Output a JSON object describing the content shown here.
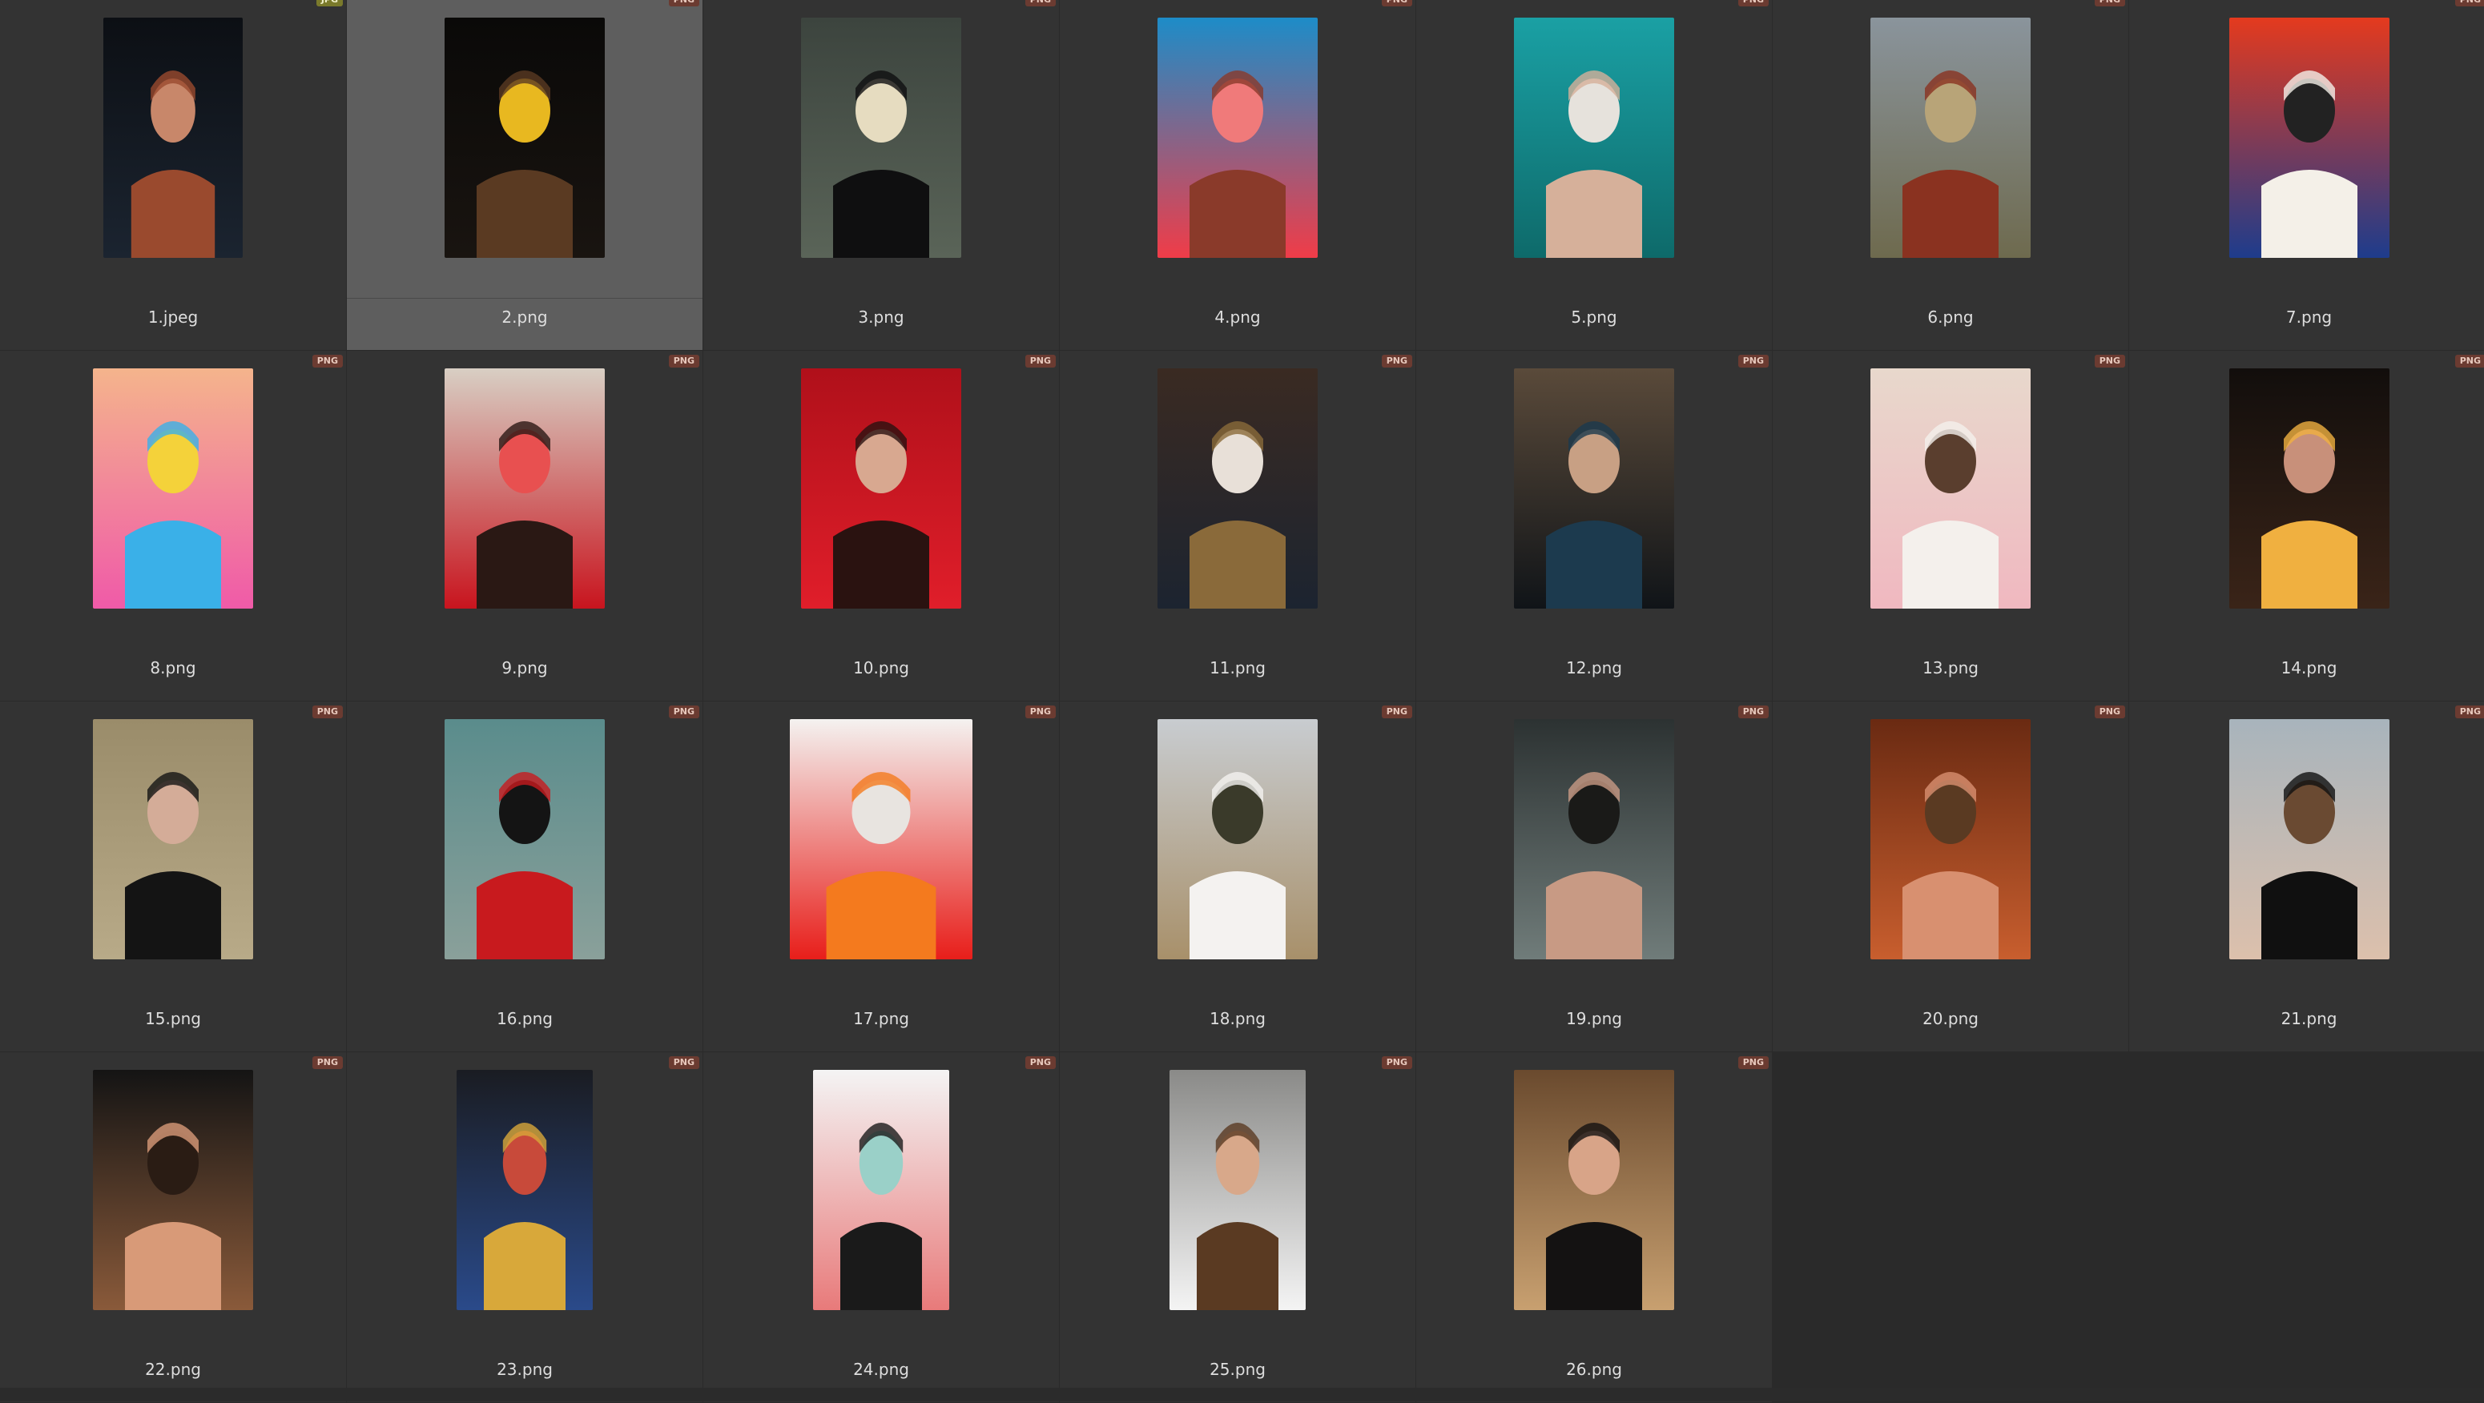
{
  "gallery": {
    "items": [
      {
        "filename": "1.jpeg",
        "badge": "JPG",
        "format": "jpg",
        "colors": [
          "#0c0f14",
          "#1b2430",
          "#9a4a2e",
          "#c8876a"
        ],
        "selected": false
      },
      {
        "filename": "2.png",
        "badge": "PNG",
        "format": "png",
        "colors": [
          "#0a0908",
          "#191410",
          "#5a3a22",
          "#e8b820"
        ],
        "selected": true
      },
      {
        "filename": "3.png",
        "badge": "PNG",
        "format": "png",
        "colors": [
          "#3c443e",
          "#5a6458",
          "#0f0f10",
          "#e6dcc0"
        ],
        "selected": false
      },
      {
        "filename": "4.png",
        "badge": "PNG",
        "format": "png",
        "colors": [
          "#1d8cc8",
          "#f03c48",
          "#8a3a2a",
          "#f07a7a"
        ],
        "selected": false
      },
      {
        "filename": "5.png",
        "badge": "PNG",
        "format": "png",
        "colors": [
          "#1aa0a4",
          "#0e6a6a",
          "#d6b09a",
          "#e6e2dc"
        ],
        "selected": false
      },
      {
        "filename": "6.png",
        "badge": "PNG",
        "format": "png",
        "colors": [
          "#8a949c",
          "#6e6a4e",
          "#8a3220",
          "#b8a478"
        ],
        "selected": false
      },
      {
        "filename": "7.png",
        "badge": "PNG",
        "format": "png",
        "colors": [
          "#e43a1e",
          "#1e3c8c",
          "#f4f0e8",
          "#222222"
        ],
        "selected": false
      },
      {
        "filename": "8.png",
        "badge": "PNG",
        "format": "png",
        "colors": [
          "#f4b48c",
          "#f05aa8",
          "#3ab0e8",
          "#f4d23a"
        ],
        "selected": false
      },
      {
        "filename": "9.png",
        "badge": "PNG",
        "format": "png",
        "colors": [
          "#d8cfc4",
          "#c8141e",
          "#2a1814",
          "#e85050"
        ],
        "selected": false
      },
      {
        "filename": "10.png",
        "badge": "PNG",
        "format": "png",
        "colors": [
          "#b0101a",
          "#e01e2a",
          "#2a1210",
          "#d8a890"
        ],
        "selected": false
      },
      {
        "filename": "11.png",
        "badge": "PNG",
        "format": "png",
        "colors": [
          "#3a2a22",
          "#1c2430",
          "#8a6a3a",
          "#e8e0d8"
        ],
        "selected": false
      },
      {
        "filename": "12.png",
        "badge": "PNG",
        "format": "png",
        "colors": [
          "#5a4a3a",
          "#101418",
          "#1c3a4e",
          "#c8a084"
        ],
        "selected": false
      },
      {
        "filename": "13.png",
        "badge": "PNG",
        "format": "png",
        "colors": [
          "#e8d8cc",
          "#f0b8c0",
          "#f4f0ec",
          "#5a3e2e"
        ],
        "selected": false
      },
      {
        "filename": "14.png",
        "badge": "PNG",
        "format": "png",
        "colors": [
          "#120e0c",
          "#3a2418",
          "#f0b040",
          "#c8907a"
        ],
        "selected": false
      },
      {
        "filename": "15.png",
        "badge": "PNG",
        "format": "png",
        "colors": [
          "#9a8c6a",
          "#b8aa88",
          "#141414",
          "#d4ac98"
        ],
        "selected": false
      },
      {
        "filename": "16.png",
        "badge": "PNG",
        "format": "png",
        "colors": [
          "#5a8c8c",
          "#8aa09a",
          "#c81a1e",
          "#141414"
        ],
        "selected": false
      },
      {
        "filename": "17.png",
        "badge": "PNG",
        "format": "png",
        "colors": [
          "#f4f2f0",
          "#e81e1a",
          "#f47a1e",
          "#e8e4e0"
        ],
        "selected": false
      },
      {
        "filename": "18.png",
        "badge": "PNG",
        "format": "png",
        "colors": [
          "#c8ccd0",
          "#a8906a",
          "#f4f2f0",
          "#3a3a2a"
        ],
        "selected": false
      },
      {
        "filename": "19.png",
        "badge": "PNG",
        "format": "png",
        "colors": [
          "#2c3232",
          "#707c7a",
          "#c89a84",
          "#1a1a18"
        ],
        "selected": false
      },
      {
        "filename": "20.png",
        "badge": "PNG",
        "format": "png",
        "colors": [
          "#6a2a12",
          "#c85e2e",
          "#d89070",
          "#5a3a22"
        ],
        "selected": false
      },
      {
        "filename": "21.png",
        "badge": "PNG",
        "format": "png",
        "colors": [
          "#a8b4bc",
          "#dcc0ac",
          "#101010",
          "#6a4a32"
        ],
        "selected": false
      },
      {
        "filename": "22.png",
        "badge": "PNG",
        "format": "png",
        "colors": [
          "#141414",
          "#8a5a3a",
          "#d89a78",
          "#2a1c14"
        ],
        "selected": false
      },
      {
        "filename": "23.png",
        "badge": "PNG",
        "format": "png",
        "colors": [
          "#1a1c22",
          "#2a4a8a",
          "#d8a83a",
          "#c84a3a"
        ],
        "selected": false
      },
      {
        "filename": "24.png",
        "badge": "PNG",
        "format": "png",
        "colors": [
          "#f4f4f4",
          "#e87a7a",
          "#1a1a1a",
          "#9ad0c8"
        ],
        "selected": false
      },
      {
        "filename": "25.png",
        "badge": "PNG",
        "format": "png",
        "colors": [
          "#8a8a88",
          "#f4f4f4",
          "#5a3a22",
          "#d8a88a"
        ],
        "selected": false
      },
      {
        "filename": "26.png",
        "badge": "PNG",
        "format": "png",
        "colors": [
          "#6a4a2e",
          "#c8a070",
          "#141212",
          "#d8a488"
        ],
        "selected": false
      }
    ]
  }
}
